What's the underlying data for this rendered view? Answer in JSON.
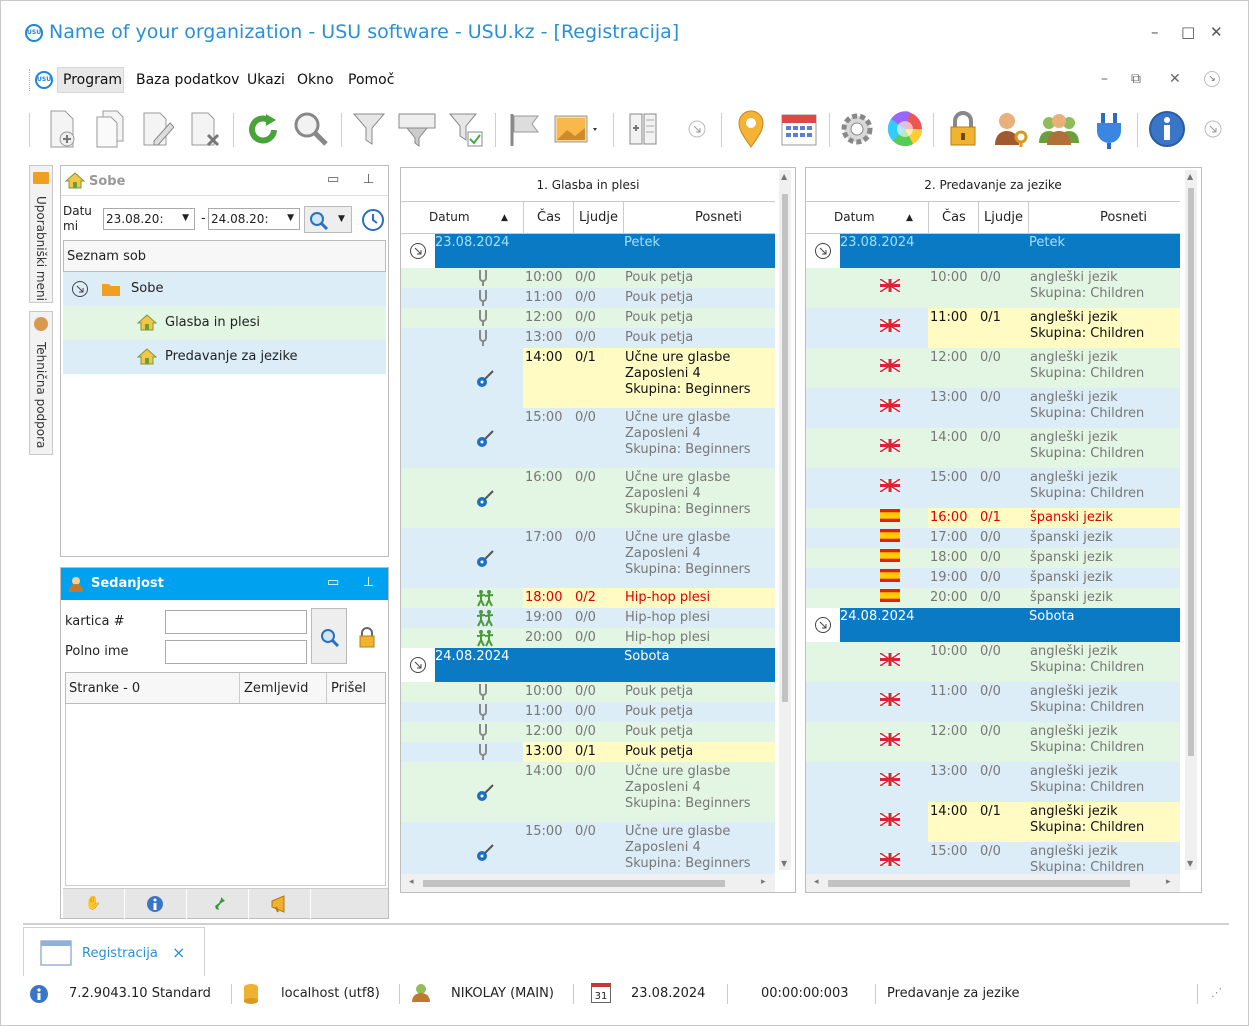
{
  "window": {
    "title": "Name of your organization - USU software - USU.kz - [Registracija]",
    "logo_text": "USU"
  },
  "menu": {
    "items": [
      "Program",
      "Baza podatkov",
      "Ukazi",
      "Okno",
      "Pomoč"
    ]
  },
  "sidebar": {
    "tab1": "Uporabniški meni",
    "tab2": "Tehnična podpora"
  },
  "rooms_panel": {
    "title": "Sobe",
    "date_label": "Datu mi",
    "date_from": "23.08.20:",
    "date_sep": "-",
    "date_to": "24.08.20:",
    "list_header": "Seznam sob",
    "tree_root": "Sobe",
    "tree_items": [
      "Glasba in plesi",
      "Predavanje za jezike"
    ]
  },
  "presence_panel": {
    "title": "Sedanjost",
    "card_label": "kartica #",
    "name_label": "Polno ime",
    "columns": [
      "Stranke - 0",
      "Zemljevid",
      "Prišel"
    ]
  },
  "grid1": {
    "title": "1. Glasba in plesi",
    "columns": [
      "Datum",
      "Čas",
      "Ljudje",
      "Posneti"
    ],
    "rows": [
      {
        "kind": "day",
        "date": "23.08.2024",
        "day": "Petek"
      },
      {
        "kind": "row",
        "bg": "g",
        "icon": "tuning-fork-icon",
        "time": "10:00",
        "people": "0/0",
        "text": [
          "Pouk petja"
        ],
        "tone": "gray"
      },
      {
        "kind": "row",
        "bg": "b",
        "icon": "tuning-fork-icon",
        "time": "11:00",
        "people": "0/0",
        "text": [
          "Pouk petja"
        ],
        "tone": "gray"
      },
      {
        "kind": "row",
        "bg": "g",
        "icon": "tuning-fork-icon",
        "time": "12:00",
        "people": "0/0",
        "text": [
          "Pouk petja"
        ],
        "tone": "gray"
      },
      {
        "kind": "row",
        "bg": "b",
        "icon": "tuning-fork-icon",
        "time": "13:00",
        "people": "0/0",
        "text": [
          "Pouk petja"
        ],
        "tone": "gray"
      },
      {
        "kind": "row",
        "bg": "y",
        "icon": "guitar-icon",
        "time": "14:00",
        "people": "0/1",
        "text": [
          "Učne ure glasbe",
          "Zaposleni 4",
          "Skupina: Beginners"
        ],
        "tone": "blk"
      },
      {
        "kind": "row",
        "bg": "b",
        "icon": "guitar-icon",
        "time": "15:00",
        "people": "0/0",
        "text": [
          "Učne ure glasbe",
          "Zaposleni 4",
          "Skupina: Beginners"
        ],
        "tone": "gray"
      },
      {
        "kind": "row",
        "bg": "g",
        "icon": "guitar-icon",
        "time": "16:00",
        "people": "0/0",
        "text": [
          "Učne ure glasbe",
          "Zaposleni 4",
          "Skupina: Beginners"
        ],
        "tone": "gray"
      },
      {
        "kind": "row",
        "bg": "b",
        "icon": "guitar-icon",
        "time": "17:00",
        "people": "0/0",
        "text": [
          "Učne ure glasbe",
          "Zaposleni 4",
          "Skupina: Beginners"
        ],
        "tone": "gray"
      },
      {
        "kind": "row",
        "bg": "y",
        "icon": "dancers-icon",
        "time": "18:00",
        "people": "0/2",
        "text": [
          "Hip-hop plesi"
        ],
        "tone": "red"
      },
      {
        "kind": "row",
        "bg": "b",
        "icon": "dancers-icon",
        "time": "19:00",
        "people": "0/0",
        "text": [
          "Hip-hop plesi"
        ],
        "tone": "gray"
      },
      {
        "kind": "row",
        "bg": "g",
        "icon": "dancers-icon",
        "time": "20:00",
        "people": "0/0",
        "text": [
          "Hip-hop plesi"
        ],
        "tone": "gray"
      },
      {
        "kind": "day",
        "date": "24.08.2024",
        "day": "Sobota"
      },
      {
        "kind": "row",
        "bg": "g",
        "icon": "tuning-fork-icon",
        "time": "10:00",
        "people": "0/0",
        "text": [
          "Pouk petja"
        ],
        "tone": "gray"
      },
      {
        "kind": "row",
        "bg": "b",
        "icon": "tuning-fork-icon",
        "time": "11:00",
        "people": "0/0",
        "text": [
          "Pouk petja"
        ],
        "tone": "gray"
      },
      {
        "kind": "row",
        "bg": "g",
        "icon": "tuning-fork-icon",
        "time": "12:00",
        "people": "0/0",
        "text": [
          "Pouk petja"
        ],
        "tone": "gray"
      },
      {
        "kind": "row",
        "bg": "y",
        "icon": "tuning-fork-icon",
        "time": "13:00",
        "people": "0/1",
        "text": [
          "Pouk petja"
        ],
        "tone": "blk"
      },
      {
        "kind": "row",
        "bg": "g",
        "icon": "guitar-icon",
        "time": "14:00",
        "people": "0/0",
        "text": [
          "Učne ure glasbe",
          "Zaposleni 4",
          "Skupina: Beginners"
        ],
        "tone": "gray"
      },
      {
        "kind": "row",
        "bg": "b",
        "icon": "guitar-icon",
        "time": "15:00",
        "people": "0/0",
        "text": [
          "Učne ure glasbe",
          "Zaposleni 4",
          "Skupina: Beginners"
        ],
        "tone": "gray"
      }
    ]
  },
  "grid2": {
    "title": "2. Predavanje za jezike",
    "columns": [
      "Datum",
      "Čas",
      "Ljudje",
      "Posneti"
    ],
    "rows": [
      {
        "kind": "day",
        "date": "23.08.2024",
        "day": "Petek"
      },
      {
        "kind": "row",
        "bg": "g",
        "icon": "uk-flag-icon",
        "time": "10:00",
        "people": "0/0",
        "text": [
          "angleški jezik",
          "Skupina: Children"
        ],
        "tone": "gray"
      },
      {
        "kind": "row",
        "bg": "y",
        "icon": "uk-flag-icon",
        "time": "11:00",
        "people": "0/1",
        "text": [
          "angleški jezik",
          "Skupina: Children"
        ],
        "tone": "blk"
      },
      {
        "kind": "row",
        "bg": "g",
        "icon": "uk-flag-icon",
        "time": "12:00",
        "people": "0/0",
        "text": [
          "angleški jezik",
          "Skupina: Children"
        ],
        "tone": "gray"
      },
      {
        "kind": "row",
        "bg": "b",
        "icon": "uk-flag-icon",
        "time": "13:00",
        "people": "0/0",
        "text": [
          "angleški jezik",
          "Skupina: Children"
        ],
        "tone": "gray"
      },
      {
        "kind": "row",
        "bg": "g",
        "icon": "uk-flag-icon",
        "time": "14:00",
        "people": "0/0",
        "text": [
          "angleški jezik",
          "Skupina: Children"
        ],
        "tone": "gray"
      },
      {
        "kind": "row",
        "bg": "b",
        "icon": "uk-flag-icon",
        "time": "15:00",
        "people": "0/0",
        "text": [
          "angleški jezik",
          "Skupina: Children"
        ],
        "tone": "gray"
      },
      {
        "kind": "row",
        "bg": "y",
        "icon": "spain-flag-icon",
        "time": "16:00",
        "people": "0/1",
        "text": [
          "španski jezik"
        ],
        "tone": "red"
      },
      {
        "kind": "row",
        "bg": "b",
        "icon": "spain-flag-icon",
        "time": "17:00",
        "people": "0/0",
        "text": [
          "španski jezik"
        ],
        "tone": "gray"
      },
      {
        "kind": "row",
        "bg": "g",
        "icon": "spain-flag-icon",
        "time": "18:00",
        "people": "0/0",
        "text": [
          "španski jezik"
        ],
        "tone": "gray"
      },
      {
        "kind": "row",
        "bg": "b",
        "icon": "spain-flag-icon",
        "time": "19:00",
        "people": "0/0",
        "text": [
          "španski jezik"
        ],
        "tone": "gray"
      },
      {
        "kind": "row",
        "bg": "g",
        "icon": "spain-flag-icon",
        "time": "20:00",
        "people": "0/0",
        "text": [
          "španski jezik"
        ],
        "tone": "gray"
      },
      {
        "kind": "day",
        "date": "24.08.2024",
        "day": "Sobota"
      },
      {
        "kind": "row",
        "bg": "g",
        "icon": "uk-flag-icon",
        "time": "10:00",
        "people": "0/0",
        "text": [
          "angleški jezik",
          "Skupina: Children"
        ],
        "tone": "gray"
      },
      {
        "kind": "row",
        "bg": "b",
        "icon": "uk-flag-icon",
        "time": "11:00",
        "people": "0/0",
        "text": [
          "angleški jezik",
          "Skupina: Children"
        ],
        "tone": "gray"
      },
      {
        "kind": "row",
        "bg": "g",
        "icon": "uk-flag-icon",
        "time": "12:00",
        "people": "0/0",
        "text": [
          "angleški jezik",
          "Skupina: Children"
        ],
        "tone": "gray"
      },
      {
        "kind": "row",
        "bg": "b",
        "icon": "uk-flag-icon",
        "time": "13:00",
        "people": "0/0",
        "text": [
          "angleški jezik",
          "Skupina: Children"
        ],
        "tone": "gray"
      },
      {
        "kind": "row",
        "bg": "y",
        "icon": "uk-flag-icon",
        "time": "14:00",
        "people": "0/1",
        "text": [
          "angleški jezik",
          "Skupina: Children"
        ],
        "tone": "blk"
      },
      {
        "kind": "row",
        "bg": "b",
        "icon": "uk-flag-icon",
        "time": "15:00",
        "people": "0/0",
        "text": [
          "angleški jezik",
          "Skupina: Children"
        ],
        "tone": "gray"
      }
    ]
  },
  "tab": {
    "label": "Registracija",
    "close": "×"
  },
  "status": {
    "version": "7.2.9043.10 Standard",
    "db": "localhost (utf8)",
    "user": "NIKOLAY (MAIN)",
    "date": "23.08.2024",
    "calendar_day": "31",
    "timer": "00:00:00:003",
    "room": "Predavanje za jezike"
  },
  "colors": {
    "accent": "#2b8fd6",
    "day_row": "#0a7ac4",
    "row_green": "#e3f6e3",
    "row_blue": "#dcedf8",
    "row_yellow": "#fffbc2",
    "presence_header": "#00a2f0"
  }
}
